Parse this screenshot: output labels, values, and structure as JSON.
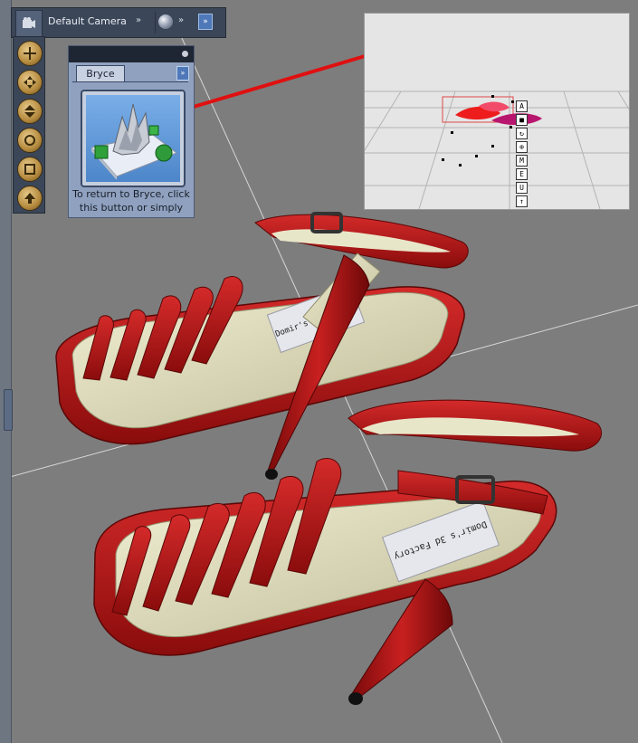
{
  "toolbar": {
    "camera_label": "Default Camera",
    "camera_dropdown": "»",
    "sphere_dropdown": "»",
    "expand_label": "»"
  },
  "tools": [
    {
      "icon": "trackball-icon"
    },
    {
      "icon": "move-xz-icon"
    },
    {
      "icon": "move-y-icon"
    },
    {
      "icon": "rotate-icon"
    },
    {
      "icon": "frame-icon"
    },
    {
      "icon": "scale-icon"
    }
  ],
  "bryce_panel": {
    "tab_label": "Bryce",
    "dropdown": "»",
    "caption_line1": "To return to Bryce, click",
    "caption_line2": "this button or simply"
  },
  "inset_tools": [
    "A",
    "■",
    "↻",
    "⊕",
    "M",
    "E",
    "U",
    "↑"
  ],
  "colors": {
    "accent_red": "#e01010",
    "shoe_red": "#b81818",
    "panel_bg": "#8fa1bf",
    "toolbar_bg": "#3b4658"
  },
  "shoe_label": {
    "upper_text": "Domir's 3d Factory",
    "lower_text": "Domir's 3d Factory"
  }
}
